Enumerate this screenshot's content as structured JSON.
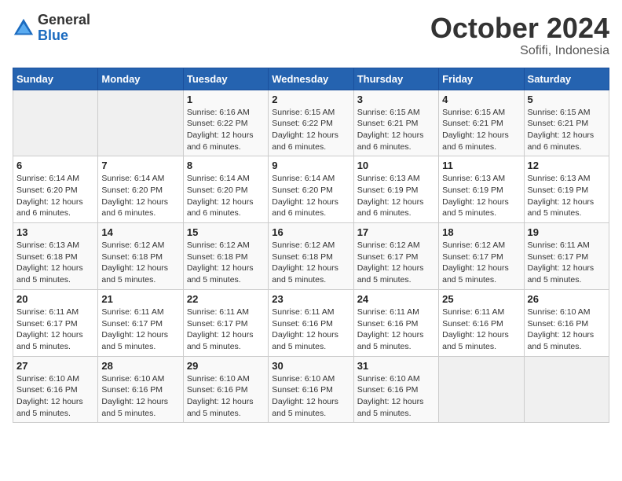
{
  "header": {
    "logo_general": "General",
    "logo_blue": "Blue",
    "title": "October 2024",
    "subtitle": "Sofifi, Indonesia"
  },
  "days_of_week": [
    "Sunday",
    "Monday",
    "Tuesday",
    "Wednesday",
    "Thursday",
    "Friday",
    "Saturday"
  ],
  "weeks": [
    [
      {
        "day": "",
        "info": ""
      },
      {
        "day": "",
        "info": ""
      },
      {
        "day": "1",
        "info": "Sunrise: 6:16 AM\nSunset: 6:22 PM\nDaylight: 12 hours and 6 minutes."
      },
      {
        "day": "2",
        "info": "Sunrise: 6:15 AM\nSunset: 6:22 PM\nDaylight: 12 hours and 6 minutes."
      },
      {
        "day": "3",
        "info": "Sunrise: 6:15 AM\nSunset: 6:21 PM\nDaylight: 12 hours and 6 minutes."
      },
      {
        "day": "4",
        "info": "Sunrise: 6:15 AM\nSunset: 6:21 PM\nDaylight: 12 hours and 6 minutes."
      },
      {
        "day": "5",
        "info": "Sunrise: 6:15 AM\nSunset: 6:21 PM\nDaylight: 12 hours and 6 minutes."
      }
    ],
    [
      {
        "day": "6",
        "info": "Sunrise: 6:14 AM\nSunset: 6:20 PM\nDaylight: 12 hours and 6 minutes."
      },
      {
        "day": "7",
        "info": "Sunrise: 6:14 AM\nSunset: 6:20 PM\nDaylight: 12 hours and 6 minutes."
      },
      {
        "day": "8",
        "info": "Sunrise: 6:14 AM\nSunset: 6:20 PM\nDaylight: 12 hours and 6 minutes."
      },
      {
        "day": "9",
        "info": "Sunrise: 6:14 AM\nSunset: 6:20 PM\nDaylight: 12 hours and 6 minutes."
      },
      {
        "day": "10",
        "info": "Sunrise: 6:13 AM\nSunset: 6:19 PM\nDaylight: 12 hours and 6 minutes."
      },
      {
        "day": "11",
        "info": "Sunrise: 6:13 AM\nSunset: 6:19 PM\nDaylight: 12 hours and 5 minutes."
      },
      {
        "day": "12",
        "info": "Sunrise: 6:13 AM\nSunset: 6:19 PM\nDaylight: 12 hours and 5 minutes."
      }
    ],
    [
      {
        "day": "13",
        "info": "Sunrise: 6:13 AM\nSunset: 6:18 PM\nDaylight: 12 hours and 5 minutes."
      },
      {
        "day": "14",
        "info": "Sunrise: 6:12 AM\nSunset: 6:18 PM\nDaylight: 12 hours and 5 minutes."
      },
      {
        "day": "15",
        "info": "Sunrise: 6:12 AM\nSunset: 6:18 PM\nDaylight: 12 hours and 5 minutes."
      },
      {
        "day": "16",
        "info": "Sunrise: 6:12 AM\nSunset: 6:18 PM\nDaylight: 12 hours and 5 minutes."
      },
      {
        "day": "17",
        "info": "Sunrise: 6:12 AM\nSunset: 6:17 PM\nDaylight: 12 hours and 5 minutes."
      },
      {
        "day": "18",
        "info": "Sunrise: 6:12 AM\nSunset: 6:17 PM\nDaylight: 12 hours and 5 minutes."
      },
      {
        "day": "19",
        "info": "Sunrise: 6:11 AM\nSunset: 6:17 PM\nDaylight: 12 hours and 5 minutes."
      }
    ],
    [
      {
        "day": "20",
        "info": "Sunrise: 6:11 AM\nSunset: 6:17 PM\nDaylight: 12 hours and 5 minutes."
      },
      {
        "day": "21",
        "info": "Sunrise: 6:11 AM\nSunset: 6:17 PM\nDaylight: 12 hours and 5 minutes."
      },
      {
        "day": "22",
        "info": "Sunrise: 6:11 AM\nSunset: 6:17 PM\nDaylight: 12 hours and 5 minutes."
      },
      {
        "day": "23",
        "info": "Sunrise: 6:11 AM\nSunset: 6:16 PM\nDaylight: 12 hours and 5 minutes."
      },
      {
        "day": "24",
        "info": "Sunrise: 6:11 AM\nSunset: 6:16 PM\nDaylight: 12 hours and 5 minutes."
      },
      {
        "day": "25",
        "info": "Sunrise: 6:11 AM\nSunset: 6:16 PM\nDaylight: 12 hours and 5 minutes."
      },
      {
        "day": "26",
        "info": "Sunrise: 6:10 AM\nSunset: 6:16 PM\nDaylight: 12 hours and 5 minutes."
      }
    ],
    [
      {
        "day": "27",
        "info": "Sunrise: 6:10 AM\nSunset: 6:16 PM\nDaylight: 12 hours and 5 minutes."
      },
      {
        "day": "28",
        "info": "Sunrise: 6:10 AM\nSunset: 6:16 PM\nDaylight: 12 hours and 5 minutes."
      },
      {
        "day": "29",
        "info": "Sunrise: 6:10 AM\nSunset: 6:16 PM\nDaylight: 12 hours and 5 minutes."
      },
      {
        "day": "30",
        "info": "Sunrise: 6:10 AM\nSunset: 6:16 PM\nDaylight: 12 hours and 5 minutes."
      },
      {
        "day": "31",
        "info": "Sunrise: 6:10 AM\nSunset: 6:16 PM\nDaylight: 12 hours and 5 minutes."
      },
      {
        "day": "",
        "info": ""
      },
      {
        "day": "",
        "info": ""
      }
    ]
  ]
}
